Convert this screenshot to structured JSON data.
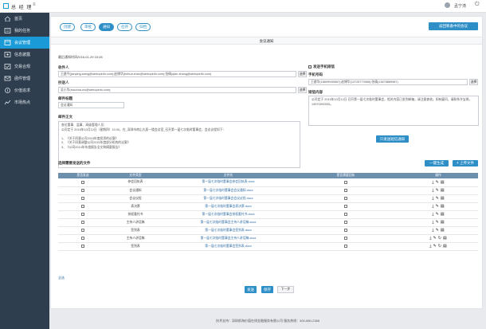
{
  "topbar": {
    "logo_text": "总 经 理",
    "user_name": "孟宁涛"
  },
  "sidebar": {
    "items": [
      {
        "label": "首页",
        "icon": "home-icon"
      },
      {
        "label": "我的任务",
        "icon": "task-icon"
      },
      {
        "label": "会议管理",
        "icon": "meeting-icon"
      },
      {
        "label": "信息披露",
        "icon": "disclosure-icon"
      },
      {
        "label": "交易合规",
        "icon": "compliance-icon"
      },
      {
        "label": "函件管理",
        "icon": "letter-icon"
      },
      {
        "label": "价值追求",
        "icon": "value-icon"
      },
      {
        "label": "市场热点",
        "icon": "hotspot-icon"
      }
    ]
  },
  "steps": [
    "创建",
    "审批",
    "通知",
    "召开",
    "归档"
  ],
  "back_label": "返回筹备中的会议",
  "page_title": "会议通知",
  "last_notice_time": "最后通知时间2016-01-29 15:28",
  "recipients": {
    "label": "收件人",
    "value": "王建平(jianping.wang@wintopinfo.com);赵博华(bohua.zhao@wintopinfo.com);张倩(qian.zhang@wintopinfo.com)",
    "select": "选择"
  },
  "cc": {
    "label": "抄送人",
    "value": "吴小华(xiaohua.wu@wintopinfo.com);",
    "select": "选择"
  },
  "subject": {
    "label": "邮件标题",
    "value": "会议通知"
  },
  "body": {
    "label": "邮件正文",
    "lines": [
      "各位董事、监事、高级管理人员：",
      "公司定于 2015年10月12日（星期四）10:30，在_深圳市南山大厦一楼会议室_召开第一届七次临时董事会，会议议程如下：",
      "",
      "1、《关于同意公司2015年度投资的议案》",
      "2、《关于同意调整公司2015年度部分机构的议案》",
      "3、《公司2014年年度报告全文和摘要报告》"
    ]
  },
  "sms": {
    "checkbox_label": "发送手机短信",
    "phone_label": "手机号码",
    "phone_value": "王建华(18699939887);赵博华(13725773965);张倩(13678889987)",
    "select": "选择",
    "content_label": "短信内容",
    "content": "公司定于 2015年10月12日 召开第一届七次临时董事会，相关内容已发到邮箱，请注意查收。如有疑问，请联系许宝珠，13970992005。",
    "button": "只发送短信通知"
  },
  "files": {
    "label": "选择需要发送的文件",
    "generate": "一键生成",
    "upload": "上传文件",
    "headers": [
      "是否发送",
      "文件类型",
      "文件名",
      "是否需要回执",
      "操作"
    ],
    "rows": [
      {
        "type": "参会回执表",
        "name": "第一届七次临时董事会参会回执表.docx"
      },
      {
        "type": "会议通知",
        "name": "第一届七次临时董事会会议通知.docx"
      },
      {
        "type": "会议议程",
        "name": "第一届七次临时董事会会议议程.docx"
      },
      {
        "type": "表决票",
        "name": "第一届七次临时董事会表决票.docx"
      },
      {
        "type": "授权委托书",
        "name": "第一届七次临时董事会授权委托书.docx"
      },
      {
        "type": "主持人讲话稿",
        "name": "第一届七次临时董事会主持人讲话稿.docx"
      },
      {
        "type": "签到表",
        "name": "第一届七次临时董事会签到表.docx"
      },
      {
        "type": "主持人讲话稿",
        "name": "第一届七次临时董事会主持人讲话稿.docx"
      },
      {
        "type": "签到表",
        "name": "第一届七次临时董事会签到表.docx"
      }
    ],
    "select_all": "全选"
  },
  "actions": {
    "send": "发送",
    "save": "保存",
    "next": "下一步"
  },
  "footer": "技术支持：深圳前海价值在线金融服务有限公司  服务热线：400-880-2388"
}
